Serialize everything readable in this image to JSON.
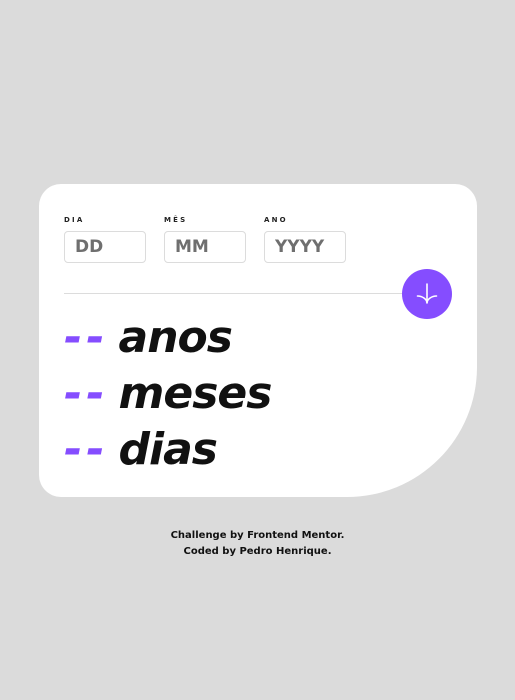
{
  "form": {
    "day": {
      "label": "DIA",
      "placeholder": "DD",
      "value": ""
    },
    "month": {
      "label": "MÊS",
      "placeholder": "MM",
      "value": ""
    },
    "year": {
      "label": "ANO",
      "placeholder": "YYYY",
      "value": ""
    },
    "submit_icon": "arrow-down-icon"
  },
  "results": [
    {
      "value": "--",
      "unit": "anos"
    },
    {
      "value": "--",
      "unit": "meses"
    },
    {
      "value": "--",
      "unit": "dias"
    }
  ],
  "attribution": {
    "line1": "Challenge by Frontend Mentor.",
    "line2": "Coded by Pedro Henrique."
  },
  "colors": {
    "accent": "#854dff",
    "background": "#dbdbdb",
    "card": "#ffffff"
  }
}
